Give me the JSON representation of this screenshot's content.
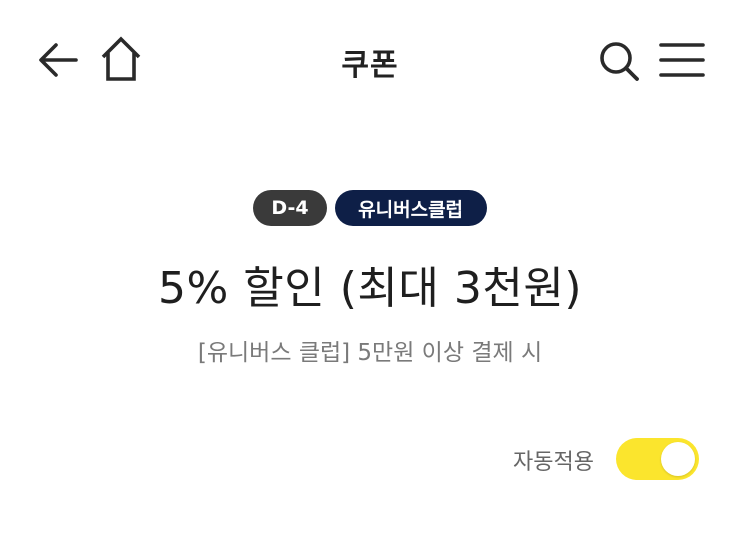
{
  "header": {
    "title": "쿠폰",
    "icons": {
      "back": "back-arrow-icon",
      "home": "home-icon",
      "search": "search-icon",
      "menu": "menu-icon"
    }
  },
  "coupon": {
    "badges": {
      "dday": "D-4",
      "club": "유니버스클럽"
    },
    "title": "5% 할인 (최대 3천원)",
    "description": "[유니버스 클럽] 5만원 이상 결제 시"
  },
  "auto_apply": {
    "label": "자동적용",
    "enabled": true
  },
  "colors": {
    "toggle_on": "#fbe52d",
    "badge_dday": "#3a3a3a",
    "badge_club": "#0e1f47"
  }
}
